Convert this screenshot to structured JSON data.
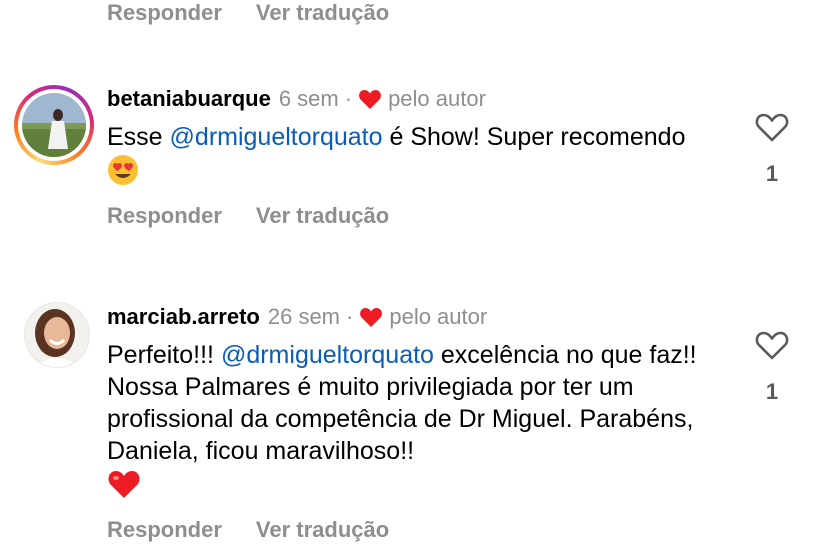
{
  "top_actions": {
    "reply": "Responder",
    "translate": "Ver tradução"
  },
  "comments": [
    {
      "username": "betaniabuarque",
      "time": "6 sem",
      "dot": "·",
      "liked_by": "pelo autor",
      "text_before": "Esse ",
      "mention": "@drmigueltorquato",
      "text_after": " é Show! Super recomendo ",
      "emoji": "heart-eyes-emoji",
      "likes": "1",
      "reply": "Responder",
      "translate": "Ver tradução"
    },
    {
      "username": "marciab.arreto",
      "time": "26 sem",
      "dot": "·",
      "liked_by": "pelo autor",
      "text_before": "Perfeito!!! ",
      "mention": "@drmigueltorquato",
      "text_after": " excelência no que faz!! Nossa Palmares é muito privilegiada por ter um profissional da competência de Dr Miguel. Parabéns, Daniela, ficou maravilhoso!!",
      "emoji": "red-heart-emoji",
      "likes": "1",
      "reply": "Responder",
      "translate": "Ver tradução"
    }
  ],
  "colors": {
    "mention": "#0a5cb8",
    "muted": "#8e8e8e",
    "heart": "#ed1c24"
  }
}
